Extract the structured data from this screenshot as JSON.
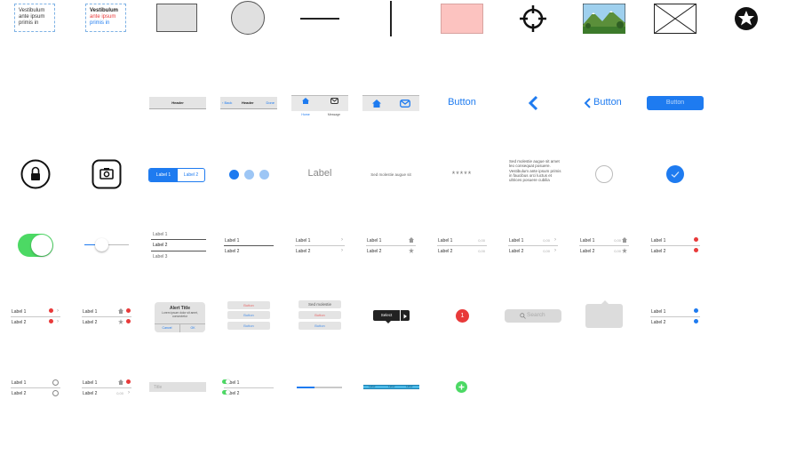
{
  "row1": {
    "note_lines": [
      "Vestibulum",
      "ante ipsum",
      "primis in"
    ],
    "note2_lines": [
      "Vestibulum",
      "ante ipsum",
      "primis in"
    ]
  },
  "row2": {
    "header_title": "Header",
    "navbar": {
      "back": "Back",
      "title": "Header",
      "done": "Done"
    },
    "tabbar": {
      "home": "Home",
      "message": "Message"
    },
    "text_button": "Button",
    "back_button": "Button",
    "filled_button": "Button"
  },
  "row3": {
    "segmented": [
      "Label 1",
      "Label 2"
    ],
    "label": "Label",
    "single_line_text": "Sed molestie augue sit",
    "password": "*****",
    "paragraph": "Sed molestie augue sit amet leo consequat posuere. Vestibulum ante ipsum primis in faucibus orci luctus et ultrices posuere cubilia"
  },
  "lists": {
    "label1": "Label 1",
    "label2": "Label 2",
    "label3": "Label 3",
    "value": "0,00"
  },
  "row5": {
    "alert": {
      "title": "Alert Title",
      "message": "Lorem ipsum dolor sit amet, consectetur",
      "cancel": "Cancel",
      "ok": "OK"
    },
    "action_sheet_buttons": [
      "Button",
      "Button",
      "Button"
    ],
    "action_sheet2": {
      "title": "Sed molestie",
      "buttons": [
        "Button",
        "Button"
      ]
    },
    "popover_select": "Select",
    "badge": "1",
    "search_placeholder": "Search"
  },
  "row6": {
    "text_field_placeholder": "Title",
    "progress_labels": [
      "Label",
      "Label",
      "Label"
    ]
  },
  "colors": {
    "accent": "#1e7bf0",
    "green": "#4cd964",
    "red": "#e83a3a",
    "pink": "#fcc3c0"
  }
}
